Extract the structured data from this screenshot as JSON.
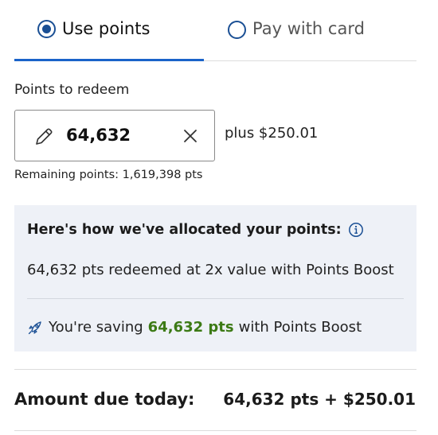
{
  "tabs": [
    {
      "label": "Use points",
      "selected": true
    },
    {
      "label": "Pay with card",
      "selected": false
    }
  ],
  "points_input": {
    "label": "Points to redeem",
    "value": "64,632",
    "plus_text": "plus $250.01",
    "remaining_text": "Remaining points: 1,619,398 pts"
  },
  "allocation": {
    "title": "Here's how we've allocated your points:",
    "line": "64,632 pts redeemed at 2x value with Points Boost",
    "saving_prefix": "You're saving",
    "saving_amount": "64,632 pts",
    "saving_suffix": "with Points Boost"
  },
  "summary": {
    "label": "Amount due today:",
    "value": "64,632 pts + $250.01"
  },
  "icons": {
    "tab1_radio": "radio-selected-icon",
    "tab2_radio": "radio-unselected-icon",
    "edit": "pencil-icon",
    "clear": "close-icon",
    "info": "info-icon",
    "boost": "rocket-icon"
  },
  "colors": {
    "accent": "#1a63c9",
    "radio": "#1a4f94",
    "panel_bg": "#eef1f7",
    "saving_green": "#3c7a15"
  }
}
